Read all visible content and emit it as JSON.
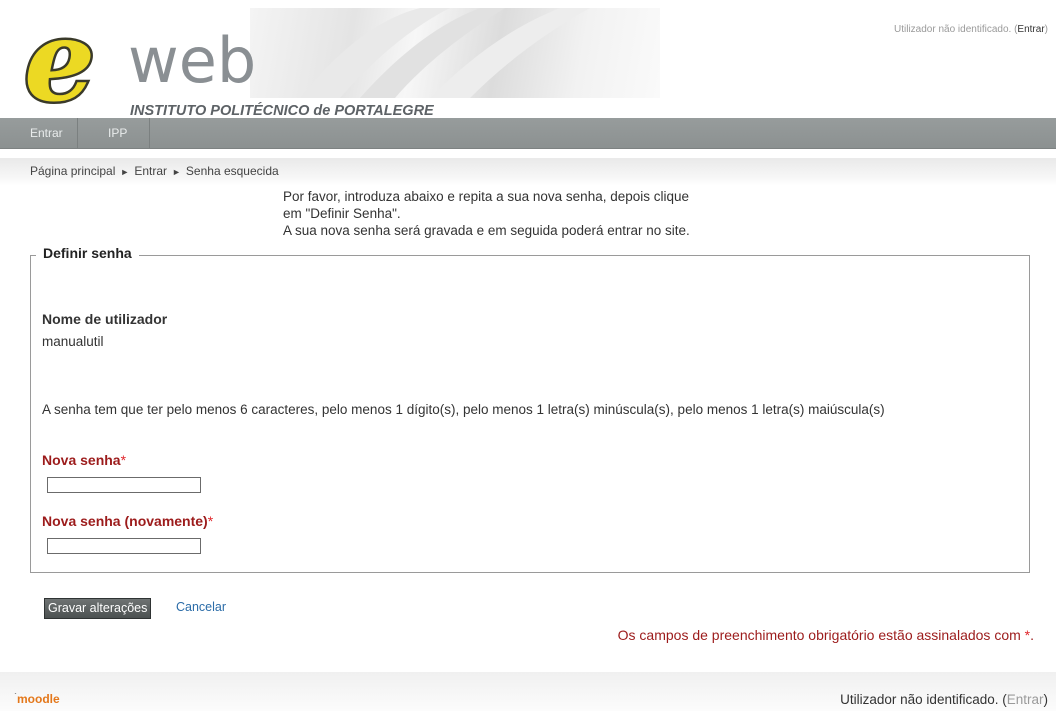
{
  "header": {
    "logo_letter": "e",
    "logo_word": "web",
    "institution": "INSTITUTO POLITÉCNICO de PORTALEGRE",
    "login_info": "Utilizador não identificado. (",
    "login_link": "Entrar",
    "login_close": ")"
  },
  "nav": {
    "items": [
      {
        "label": "Entrar"
      },
      {
        "label": "IPP"
      }
    ]
  },
  "breadcrumb": {
    "items": [
      "Página principal",
      "Entrar",
      "Senha esquecida"
    ],
    "separator": "►"
  },
  "intro": {
    "line1": "Por favor, introduza abaixo e repita a sua nova senha, depois clique",
    "line2": "em \"Definir Senha\".",
    "line3": "A sua nova senha será gravada e em seguida poderá entrar no site."
  },
  "form": {
    "legend": "Definir senha",
    "username_label": "Nome de utilizador",
    "username_value": "manualutil",
    "policy": "A senha tem que ter pelo menos 6 caracteres, pelo menos 1 dígito(s), pelo menos 1 letra(s) minúscula(s), pelo menos 1 letra(s) maiúscula(s)",
    "new_password_label": "Nova senha",
    "new_password_value": "",
    "repeat_password_label": "Nova senha (novamente)",
    "repeat_password_value": "",
    "required_star": "*"
  },
  "actions": {
    "save_label": "Gravar alterações",
    "cancel_label": "Cancelar"
  },
  "required_note": {
    "text": "Os campos de preenchimento obrigatório estão assinalados com ",
    "star": "*",
    "end": "."
  },
  "footer": {
    "moodle_logo_text": "moodle",
    "login_info": "Utilizador não identificado. (",
    "login_link": "Entrar",
    "login_close": ")"
  },
  "colors": {
    "nav_bar": "#8f9494",
    "required_label": "#9c1b1b",
    "required_star": "#e0262b",
    "link": "#2b6ca8",
    "logo_letter": "#e8d21e",
    "logo_word": "#8a8f93"
  }
}
